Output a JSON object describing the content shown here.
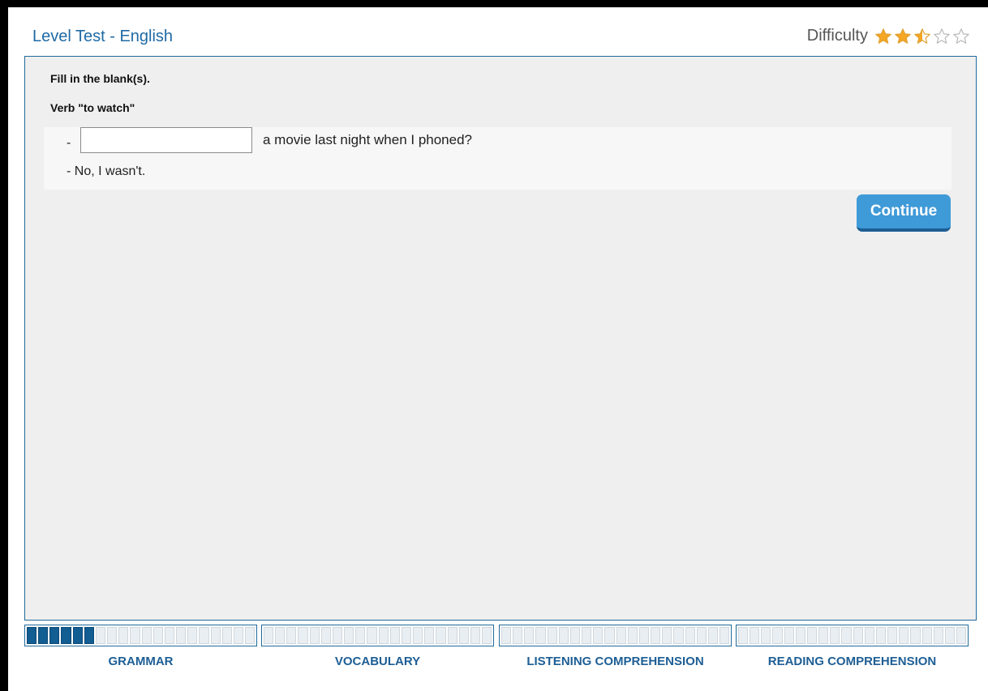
{
  "header": {
    "title": "Level Test - English",
    "difficulty_label": "Difficulty",
    "difficulty_rating": 2.5,
    "difficulty_max": 5
  },
  "exercise": {
    "instruction": "Fill in the blank(s).",
    "verb_title": "Verb \"to watch\"",
    "line1_prefix": "-",
    "line1_input_value": "",
    "line1_suffix": "a movie last night when I phoned?",
    "line2": "- No, I wasn't."
  },
  "actions": {
    "continue_label": "Continue"
  },
  "progress": {
    "sections": [
      {
        "label": "GRAMMAR",
        "completed": 6,
        "total": 20
      },
      {
        "label": "VOCABULARY",
        "completed": 0,
        "total": 20
      },
      {
        "label": "LISTENING COMPREHENSION",
        "completed": 0,
        "total": 20
      },
      {
        "label": "READING COMPREHENSION",
        "completed": 0,
        "total": 20
      }
    ]
  },
  "colors": {
    "accent": "#1f6aa5",
    "button": "#3f9ad8",
    "progress_fill": "#125d92",
    "star": "#f5a623"
  }
}
